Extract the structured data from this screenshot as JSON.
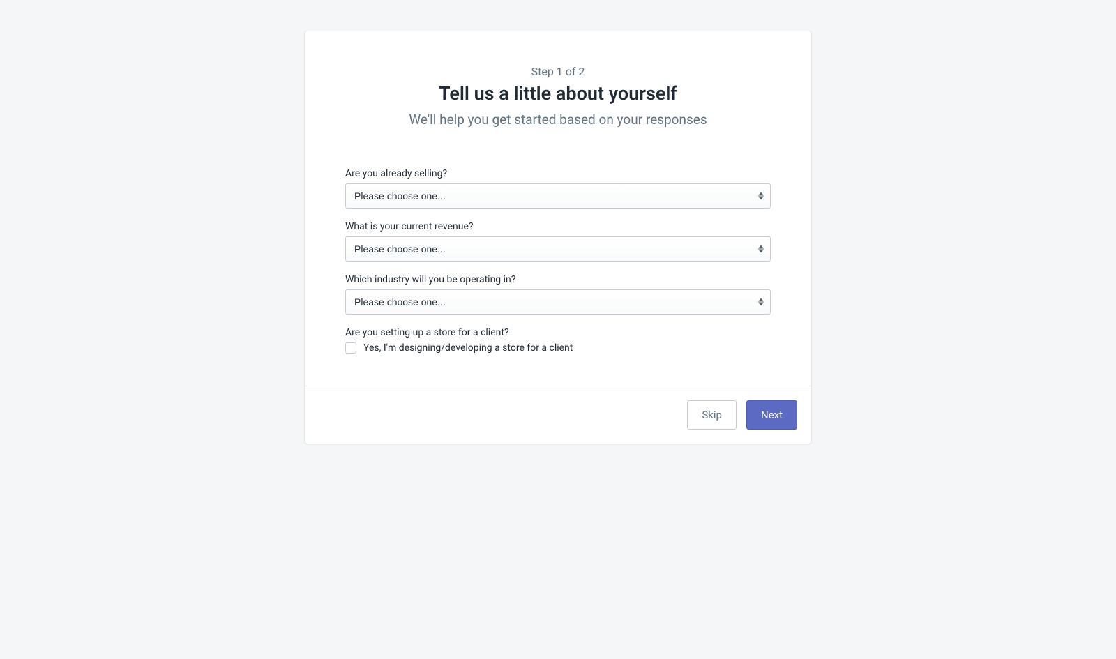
{
  "header": {
    "step_indicator": "Step 1 of 2",
    "title": "Tell us a little about yourself",
    "subtitle": "We'll help you get started based on your responses"
  },
  "form": {
    "already_selling": {
      "label": "Are you already selling?",
      "placeholder": "Please choose one..."
    },
    "current_revenue": {
      "label": "What is your current revenue?",
      "placeholder": "Please choose one..."
    },
    "industry": {
      "label": "Which industry will you be operating in?",
      "placeholder": "Please choose one..."
    },
    "client_setup": {
      "label": "Are you setting up a store for a client?",
      "checkbox_label": "Yes, I'm designing/developing a store for a client"
    }
  },
  "footer": {
    "skip_label": "Skip",
    "next_label": "Next"
  }
}
